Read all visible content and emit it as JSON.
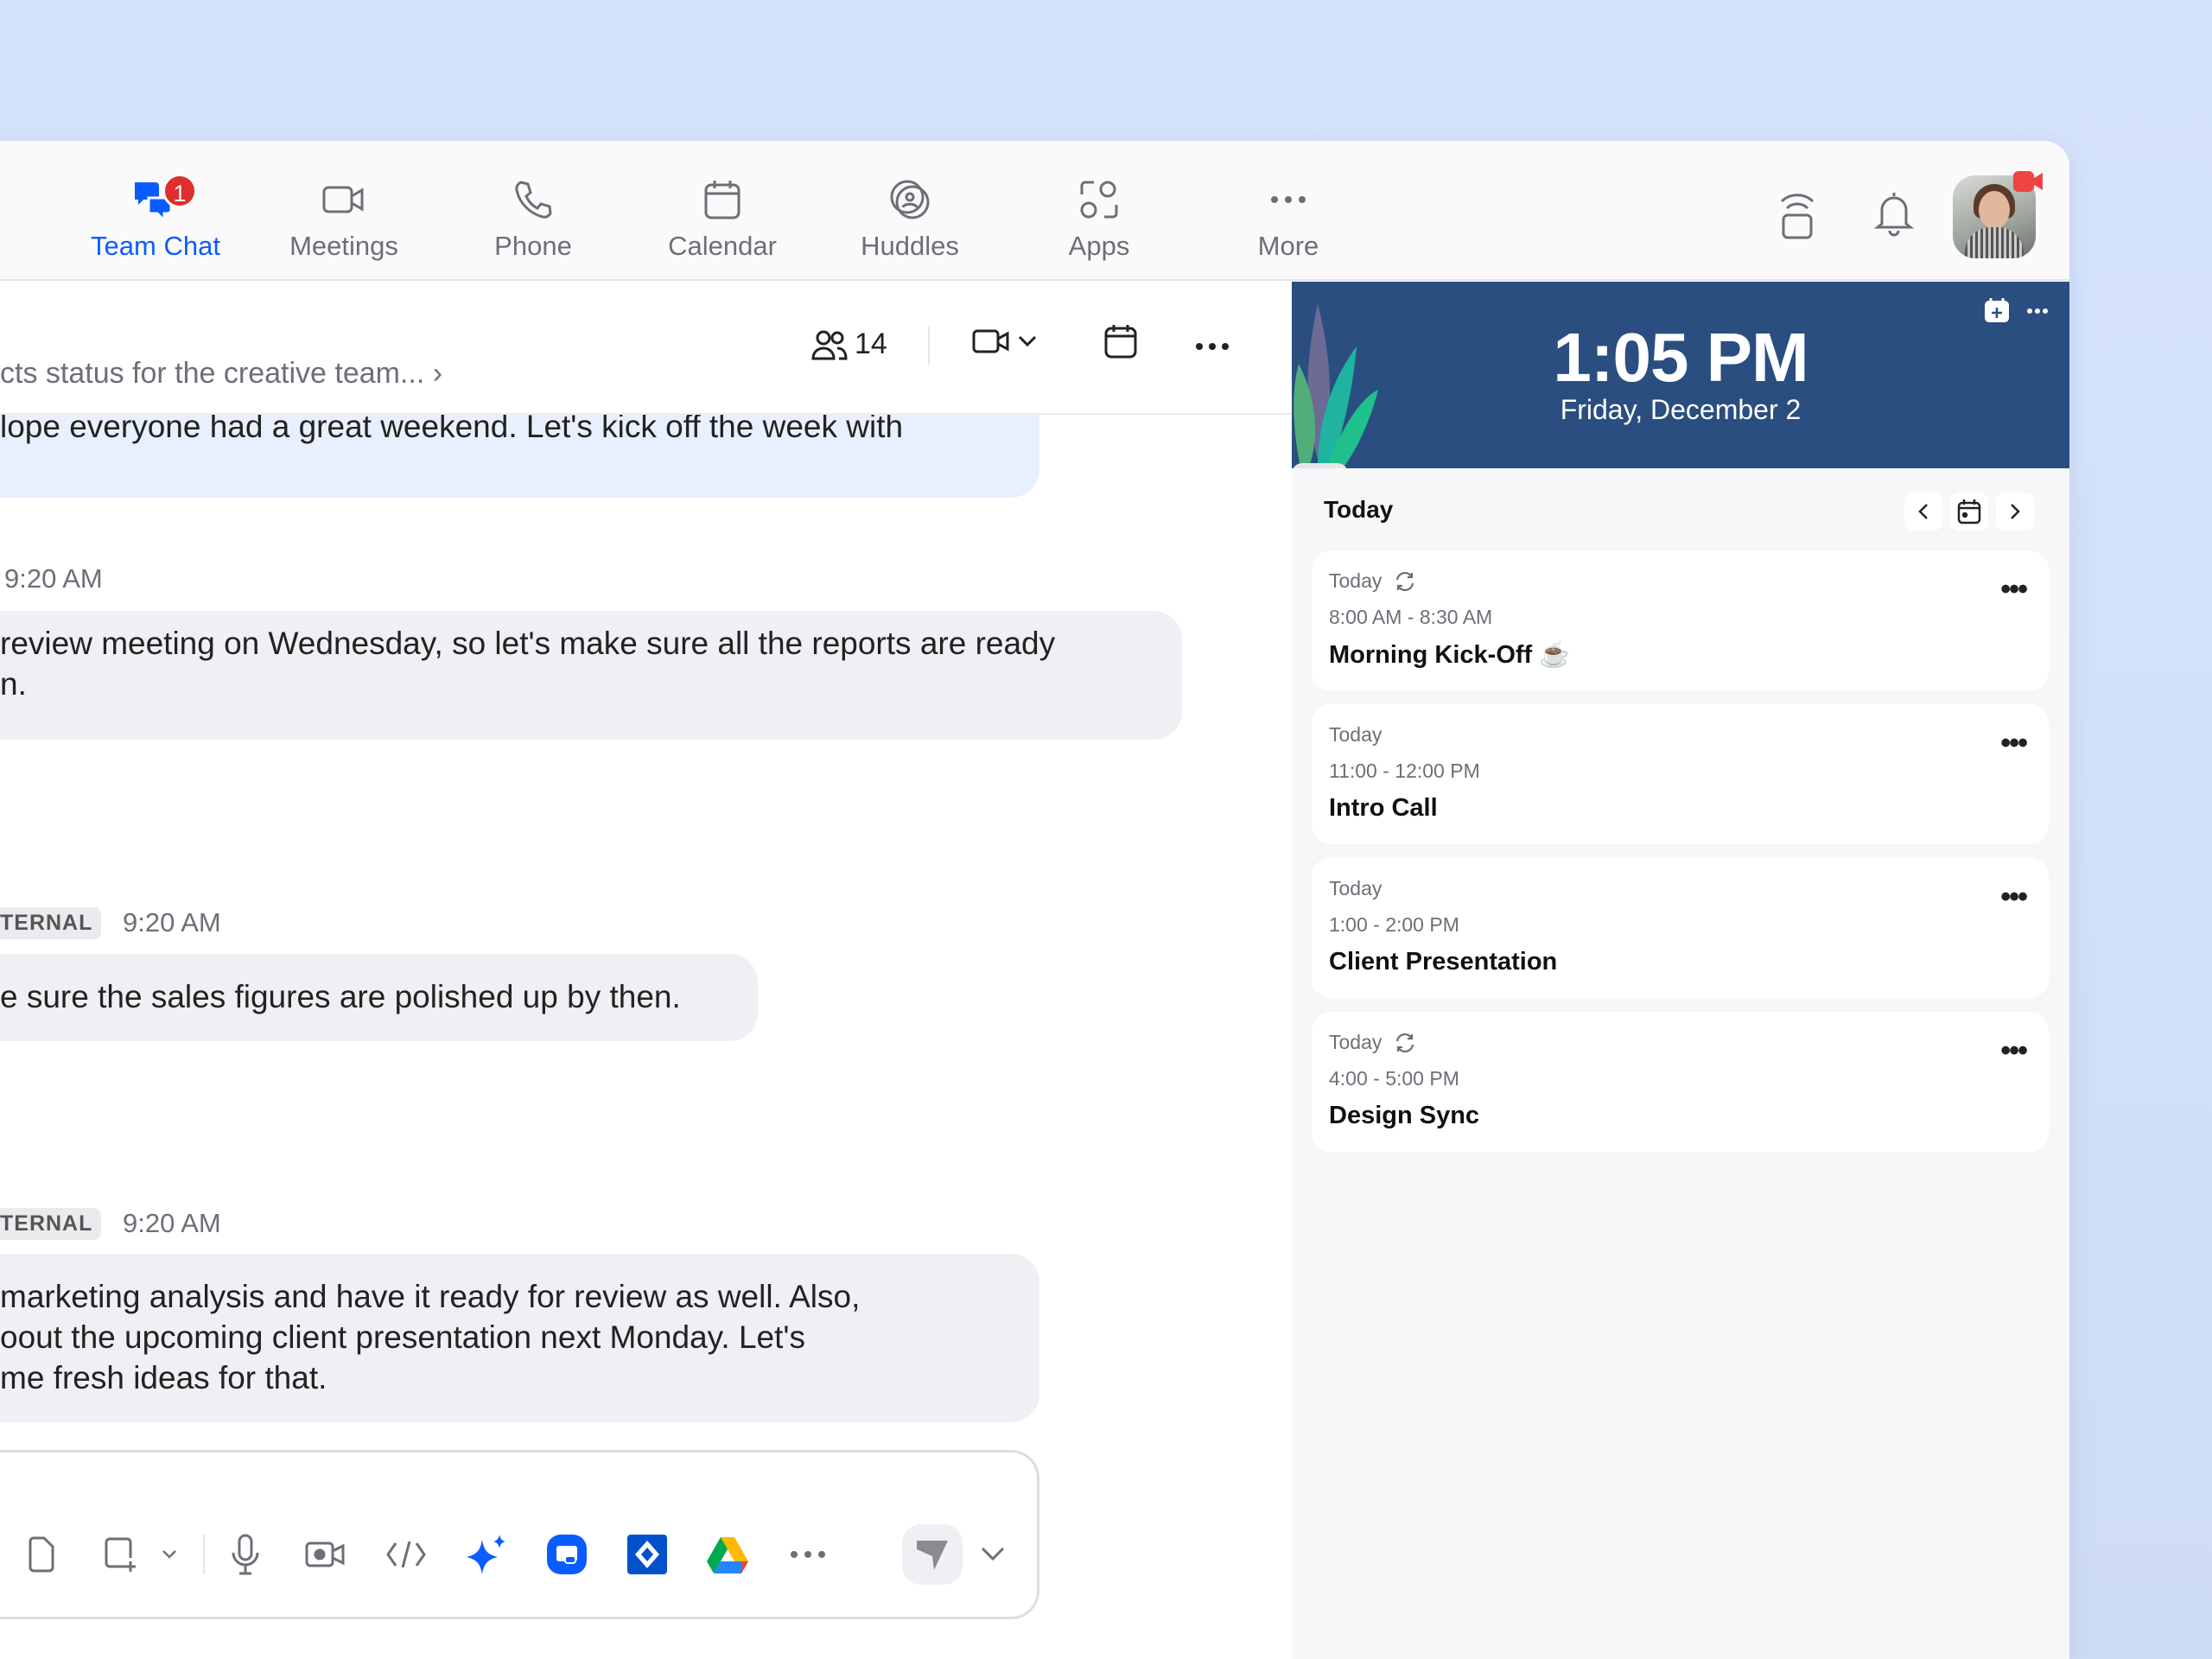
{
  "nav": {
    "items": [
      {
        "label": "Team Chat",
        "icon": "chat-icon",
        "badge": "1",
        "active": true
      },
      {
        "label": "Meetings",
        "icon": "video-camera-icon"
      },
      {
        "label": "Phone",
        "icon": "phone-icon"
      },
      {
        "label": "Calendar",
        "icon": "calendar-icon"
      },
      {
        "label": "Huddles",
        "icon": "huddles-icon"
      },
      {
        "label": "Apps",
        "icon": "apps-icon"
      },
      {
        "label": "More",
        "icon": "more-icon"
      }
    ]
  },
  "chat": {
    "subtitle": "cts status for the creative team...",
    "participants": "14",
    "messages": [
      {
        "lines": [
          "lope everyone had a great weekend. Let's kick off the week with"
        ]
      },
      {
        "time": "9:20 AM",
        "lines": [
          "review meeting on Wednesday, so let's make sure all the reports are ready",
          "n."
        ]
      },
      {
        "tag": "TERNAL",
        "time": "9:20 AM",
        "lines": [
          "e sure the sales figures are polished up by then."
        ]
      },
      {
        "tag": "TERNAL",
        "time": "9:20 AM",
        "lines": [
          "marketing analysis and have it ready for review as well. Also,",
          "oout the upcoming client presentation next Monday. Let's",
          "me fresh ideas for that."
        ]
      }
    ]
  },
  "calendar": {
    "time": "1:05 PM",
    "date": "Friday, December 2",
    "header": "Today",
    "events": [
      {
        "day": "Today",
        "recurring": true,
        "time": "8:00 AM - 8:30 AM",
        "title": "Morning Kick-Off ☕"
      },
      {
        "day": "Today",
        "recurring": false,
        "time": "11:00 - 12:00 PM",
        "title": "Intro Call"
      },
      {
        "day": "Today",
        "recurring": false,
        "time": "1:00 - 2:00 PM",
        "title": "Client Presentation"
      },
      {
        "day": "Today",
        "recurring": true,
        "time": "4:00 - 5:00 PM",
        "title": "Design Sync"
      }
    ]
  },
  "colors": {
    "accent": "#0b5cff",
    "badge": "#e02d2d",
    "banner": "#2a4e80",
    "bubble": "#efeff4",
    "bubble_self": "#e8f0fd"
  }
}
